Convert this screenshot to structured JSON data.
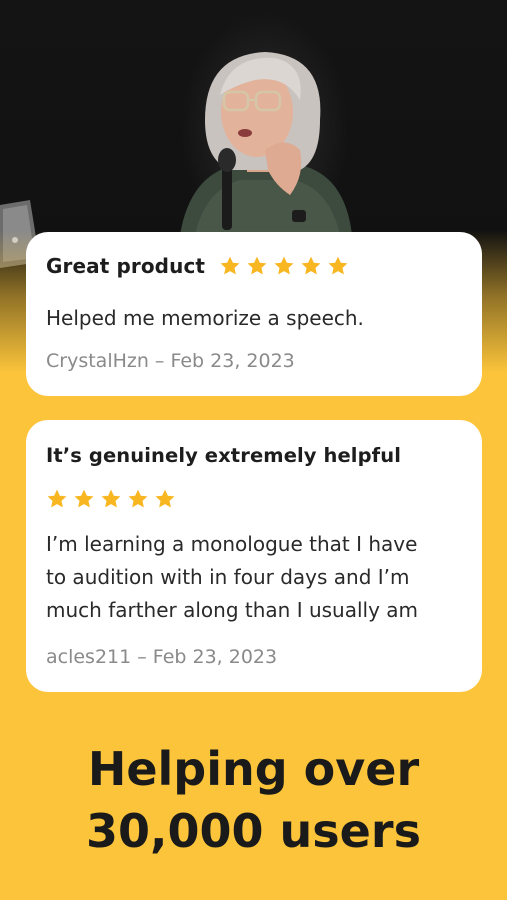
{
  "colors": {
    "background": "#fbc43a",
    "card": "#ffffff",
    "star": "#f8b621",
    "title_text": "#1d1d1d",
    "meta_text": "#8a8a8a"
  },
  "reviews": [
    {
      "title": "Great product",
      "rating": 5,
      "body_lines": [
        "Helped me memorize a speech."
      ],
      "author": "CrystalHzn",
      "date": "Feb 23, 2023",
      "meta": "CrystalHzn – Feb 23, 2023"
    },
    {
      "title": "It’s genuinely extremely helpful",
      "rating": 5,
      "body_lines": [
        "I’m learning a monologue that I have",
        "to audition with in four days and I’m",
        "much farther along than I usually am"
      ],
      "author": "acles211",
      "date": "Feb 23, 2023",
      "meta": "acles211 – Feb 23, 2023"
    }
  ],
  "headline": {
    "line1": "Helping over",
    "line2": "30,000 users"
  },
  "icons": {
    "star": "star-icon",
    "laptop": "laptop-icon"
  }
}
